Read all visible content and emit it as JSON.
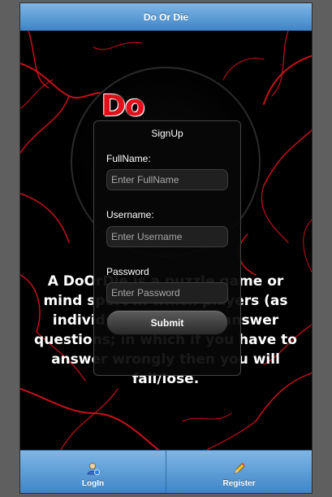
{
  "header": {
    "title": "Do Or Die"
  },
  "hero": {
    "logo_text": "Do",
    "description": "A DoOrDie is a puzzle game or mind sport in which players (as individuals or teams) answer questions; in which if you have to answer wrongly then you will fail/lose."
  },
  "signup": {
    "title": "SignUp",
    "fullname_label": "FullName:",
    "fullname_placeholder": "Enter FullName",
    "username_label": "Username:",
    "username_placeholder": "Enter Username",
    "password_label": "Password",
    "password_placeholder": "Enter Password",
    "submit_label": "Submit"
  },
  "footer": {
    "tabs": [
      {
        "label": "LogIn",
        "icon": "user-login-icon"
      },
      {
        "label": "Register",
        "icon": "pencil-icon"
      }
    ]
  },
  "colors": {
    "bar_top": "#7fb6e6",
    "bar_bottom": "#3f86c8",
    "vein": "#d0101a"
  }
}
